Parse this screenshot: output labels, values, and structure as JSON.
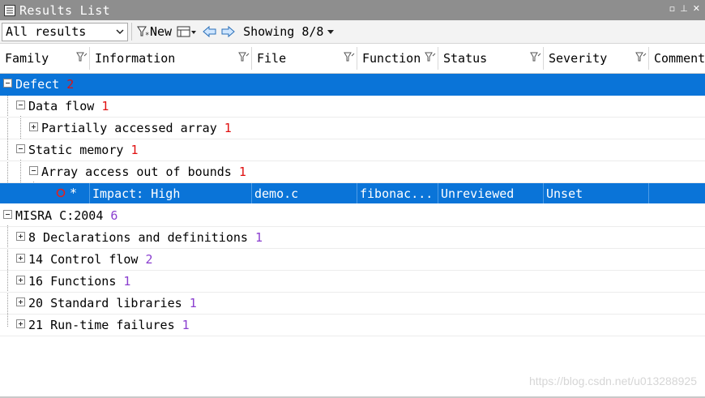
{
  "window": {
    "title": "Results List"
  },
  "toolbar": {
    "filter_value": "All results",
    "new_label": "New",
    "showing_label": "Showing 8/8"
  },
  "columns": [
    {
      "label": "Family"
    },
    {
      "label": "Information"
    },
    {
      "label": "File"
    },
    {
      "label": "Function"
    },
    {
      "label": "Status"
    },
    {
      "label": "Severity"
    },
    {
      "label": "Comment"
    }
  ],
  "tree": {
    "defect": {
      "label": "Defect",
      "count": "2"
    },
    "data_flow": {
      "label": "Data flow",
      "count": "1"
    },
    "partial_array": {
      "label": "Partially accessed array",
      "count": "1"
    },
    "static_memory": {
      "label": "Static memory",
      "count": "1"
    },
    "array_oob": {
      "label": "Array access out of bounds",
      "count": "1"
    },
    "result": {
      "marker": "*",
      "information": "Impact: High",
      "file": "demo.c",
      "function": "fibonac...",
      "status": "Unreviewed",
      "severity": "Unset",
      "comment": ""
    },
    "misra": {
      "label": "MISRA C:2004",
      "count": "6"
    },
    "misra_items": [
      {
        "label": "8 Declarations and definitions",
        "count": "1"
      },
      {
        "label": "14 Control flow",
        "count": "2"
      },
      {
        "label": "16 Functions",
        "count": "1"
      },
      {
        "label": "20 Standard libraries",
        "count": "1"
      },
      {
        "label": "21 Run-time failures",
        "count": "1"
      }
    ]
  },
  "watermark": "https://blog.csdn.net/u013288925",
  "colors": {
    "selection": "#0a74d8",
    "titlebar": "#8e8e8e",
    "count_red": "#e01010",
    "count_purple": "#8a3ecf"
  },
  "icons": [
    "results-list-icon",
    "chevron-down-icon",
    "new-filter-icon",
    "columns-menu-icon",
    "previous-arrow-icon",
    "next-arrow-icon",
    "column-filter-icon",
    "expand-icon",
    "collapse-icon",
    "defect-circle-icon"
  ]
}
